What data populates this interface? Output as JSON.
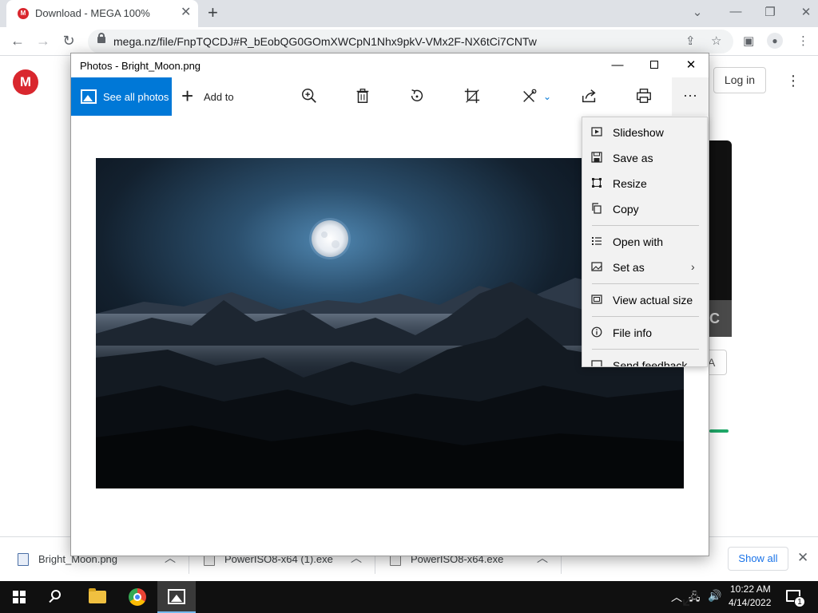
{
  "browser": {
    "tab_title": "Download - MEGA 100%",
    "favicon_letter": "M",
    "url": "mega.nz/file/FnpTQCDJ#R_bEobQG0GOmXWCpN1Nhx9pkV-VMx2F-NX6tCi7CNTw"
  },
  "mega_page": {
    "logo_letter": "M",
    "login_label": "Log in",
    "panel_letter": "C",
    "panel_button_label": "A"
  },
  "photos_window": {
    "title": "Photos - Bright_Moon.png",
    "see_all_label": "See all photos",
    "add_to_label": "Add to",
    "more_label": "···"
  },
  "context_menu": {
    "items": [
      {
        "label": "Slideshow"
      },
      {
        "label": "Save as"
      },
      {
        "label": "Resize"
      },
      {
        "label": "Copy"
      },
      {
        "label": "Open with"
      },
      {
        "label": "Set as"
      },
      {
        "label": "View actual size"
      },
      {
        "label": "File info"
      },
      {
        "label": "Send feedback"
      }
    ]
  },
  "downloads": {
    "items": [
      {
        "name": "Bright_Moon.png"
      },
      {
        "name": "PowerISO8-x64 (1).exe"
      },
      {
        "name": "PowerISO8-x64.exe"
      }
    ],
    "show_all_label": "Show all"
  },
  "taskbar": {
    "time": "10:22 AM",
    "date": "4/14/2022",
    "notification_count": "1"
  },
  "colors": {
    "accent": "#0078d7",
    "mega_red": "#d9272e",
    "taskbar": "#101010"
  }
}
